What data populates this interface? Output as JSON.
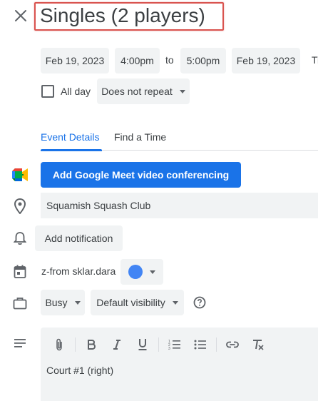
{
  "event": {
    "title": "Singles (2 players)"
  },
  "datetime": {
    "start_date": "Feb 19, 2023",
    "start_time": "4:00pm",
    "separator": "to",
    "end_time": "5:00pm",
    "end_date": "Feb 19, 2023",
    "timezone_partial": "Ti",
    "all_day_label": "All day",
    "all_day_checked": false,
    "repeat_label": "Does not repeat"
  },
  "tabs": [
    {
      "label": "Event Details",
      "active": true
    },
    {
      "label": "Find a Time",
      "active": false
    }
  ],
  "details": {
    "meet_button_label": "Add Google Meet video conferencing",
    "location_value": "Squamish Squash Club",
    "notification_button_label": "Add notification",
    "calendar_owner": "z-from sklar.dara",
    "calendar_color": "#4285f4",
    "availability_label": "Busy",
    "visibility_label": "Default visibility",
    "description_text": "Court #1 (right)"
  },
  "colors": {
    "accent": "#1a73e8",
    "highlight_border": "#d9534f",
    "chip_bg": "#f1f3f4"
  }
}
